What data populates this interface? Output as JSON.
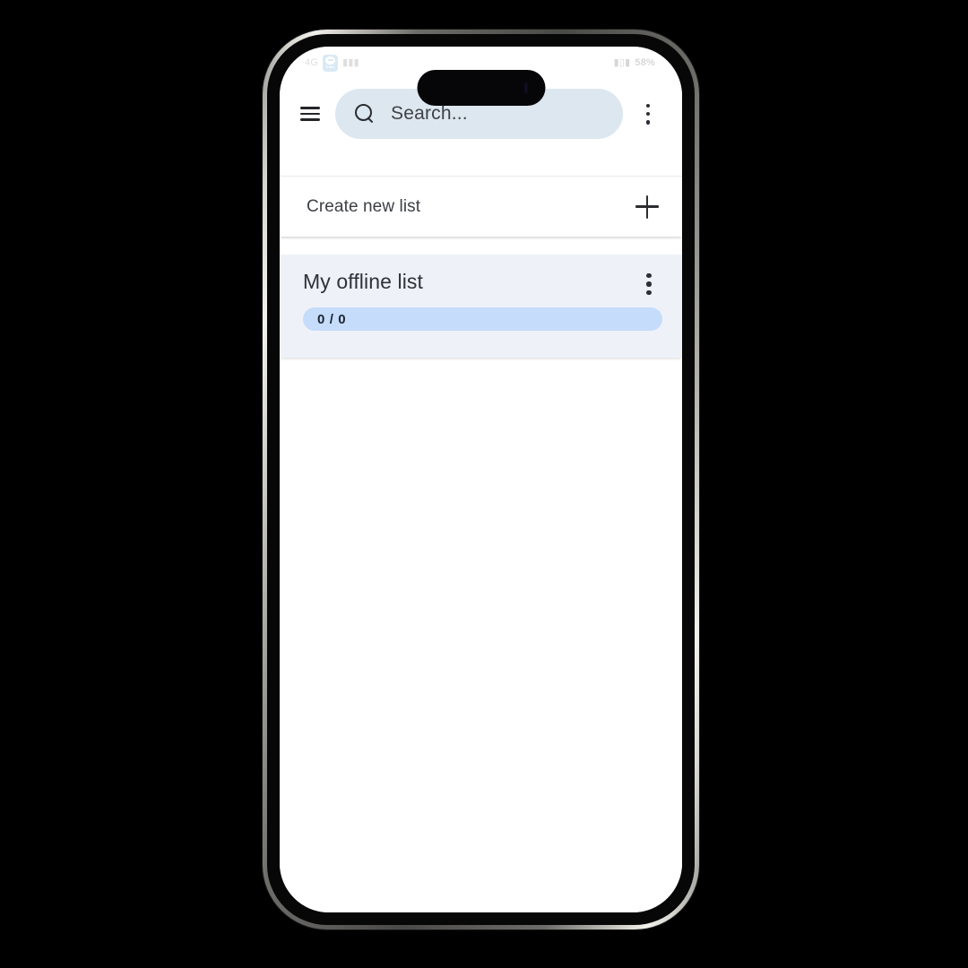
{
  "device": {
    "name": "smartphone-mockup",
    "frame_color": "#4a4947",
    "screen_bg": "#ffffff"
  },
  "status_bar": {
    "left_indicators": "4G",
    "app_badge_label": "Plan",
    "signal_glyph": "▮▮▮",
    "right_indicators": "",
    "battery_percent": "58%"
  },
  "app_bar": {
    "menu_icon": "hamburger-menu-icon",
    "overflow_icon": "kebab-menu-icon",
    "search": {
      "icon": "search-icon",
      "placeholder": "Search...",
      "value": ""
    }
  },
  "content": {
    "create_row": {
      "label": "Create new list",
      "action_icon": "plus-icon"
    },
    "lists": [
      {
        "title": "My offline list",
        "overflow_icon": "kebab-menu-icon",
        "progress_label": "0 / 0",
        "completed": 0,
        "total": 0,
        "progress_percent": 0,
        "track_color": "#c5dcfb",
        "fill_color": "#4d8df0",
        "card_color": "#eef2f8"
      }
    ]
  },
  "colors": {
    "search_field": "#dde7ef",
    "accent": "#4d8df0",
    "text_primary": "#2f3338",
    "text_secondary": "#3c4045",
    "app_badge": "#1a7fc1"
  }
}
